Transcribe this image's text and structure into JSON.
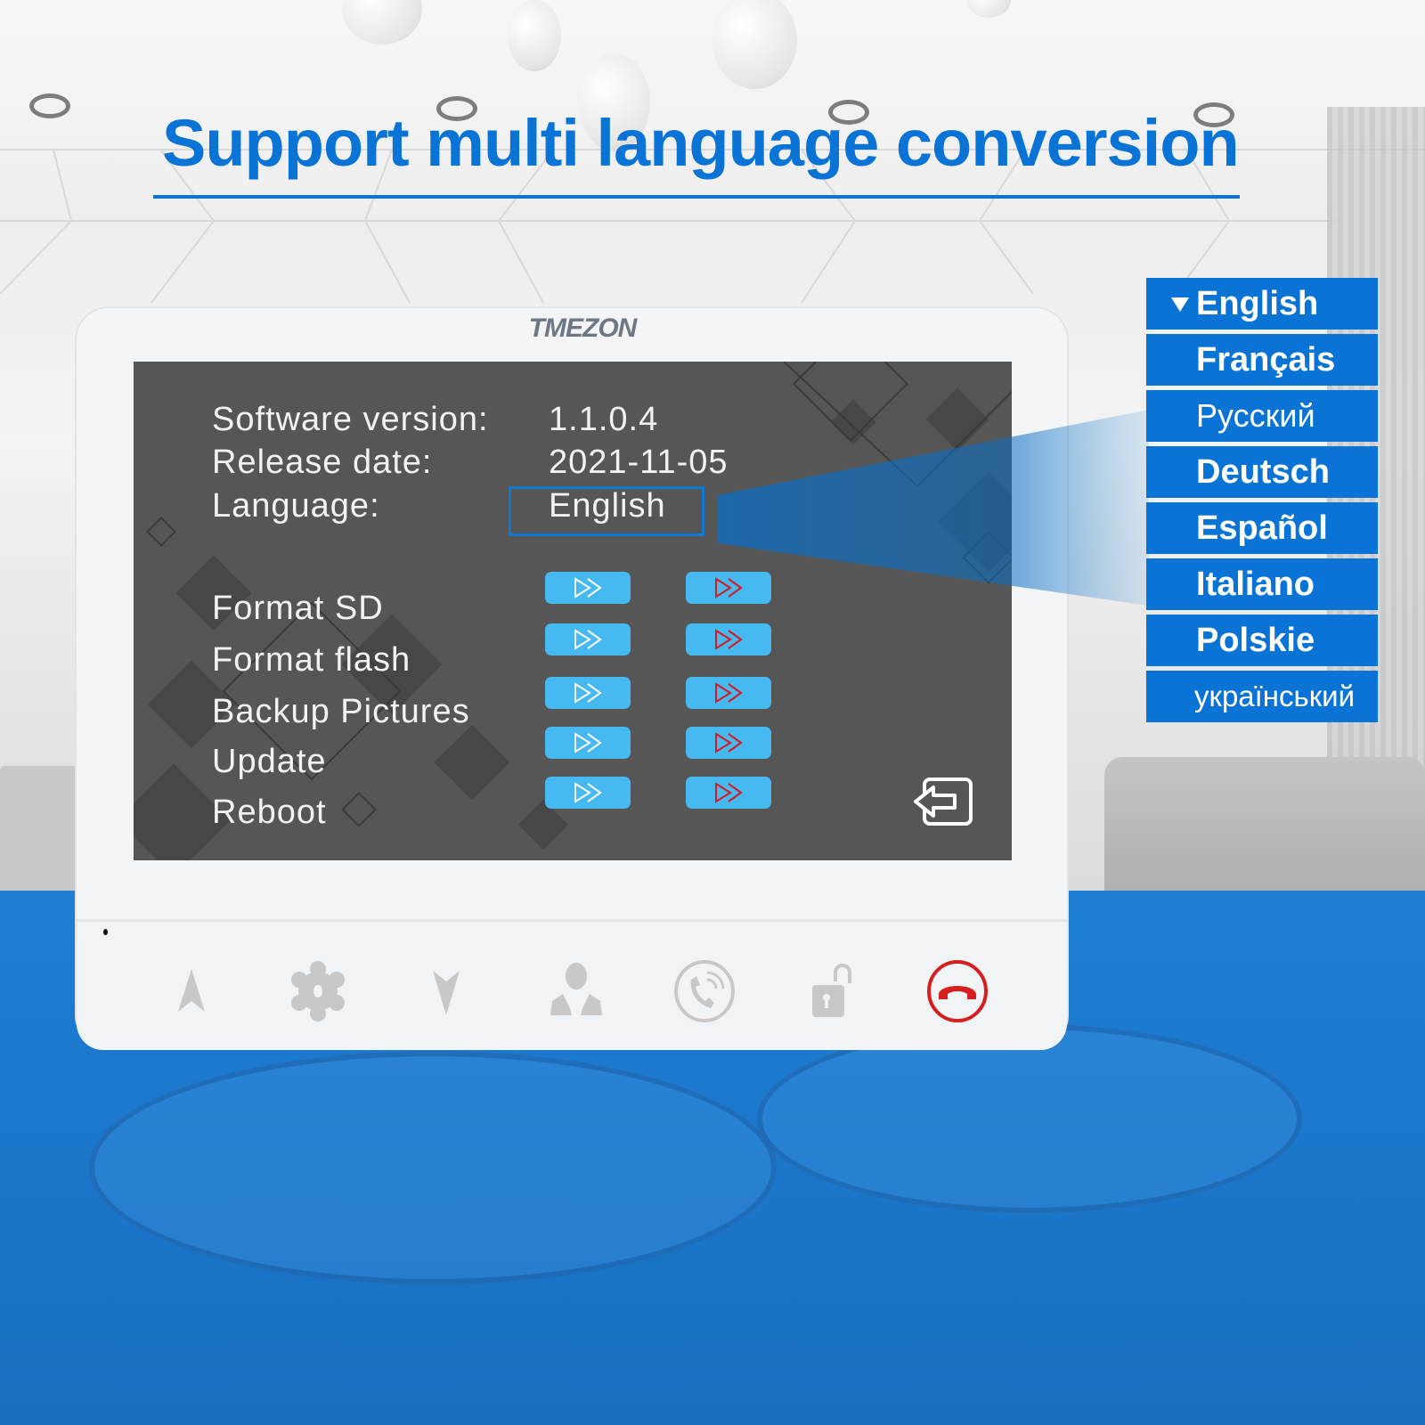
{
  "banner": {
    "title": "Support multi language conversion",
    "accent_color": "#0a74d6"
  },
  "device": {
    "brand": "TMEZON",
    "screen": {
      "info": [
        {
          "label": "Software version:",
          "value": "1.1.0.4"
        },
        {
          "label": "Release date:",
          "value": "2021-11-05"
        },
        {
          "label": "Language:",
          "value": "English"
        }
      ],
      "menu": [
        {
          "label": "Format SD"
        },
        {
          "label": "Format flash"
        },
        {
          "label": "Backup Pictures"
        },
        {
          "label": "Update"
        },
        {
          "label": "Reboot"
        }
      ],
      "action_buttons": {
        "left_icon": "double-chevron-right-outline-white",
        "right_icon": "double-chevron-right-outline-red",
        "button_color": "#45b9f0"
      },
      "exit_icon": "exit-arrow-icon"
    },
    "hardware_buttons": [
      {
        "name": "up-arrow",
        "icon": "up-triangle-icon"
      },
      {
        "name": "settings",
        "icon": "gear-icon"
      },
      {
        "name": "down-arrow",
        "icon": "down-triangle-icon"
      },
      {
        "name": "contacts",
        "icon": "user-icon"
      },
      {
        "name": "answer-call",
        "icon": "phone-ringing-icon"
      },
      {
        "name": "unlock",
        "icon": "unlock-icon"
      },
      {
        "name": "hang-up",
        "icon": "hang-up-icon",
        "color": "#d61e1e"
      }
    ]
  },
  "language_list": {
    "selected": "English",
    "items": [
      {
        "label": "English"
      },
      {
        "label": "Français"
      },
      {
        "label": "Русский"
      },
      {
        "label": "Deutsch"
      },
      {
        "label": "Español"
      },
      {
        "label": "Italiano"
      },
      {
        "label": "Polskie"
      },
      {
        "label": "український"
      }
    ]
  }
}
